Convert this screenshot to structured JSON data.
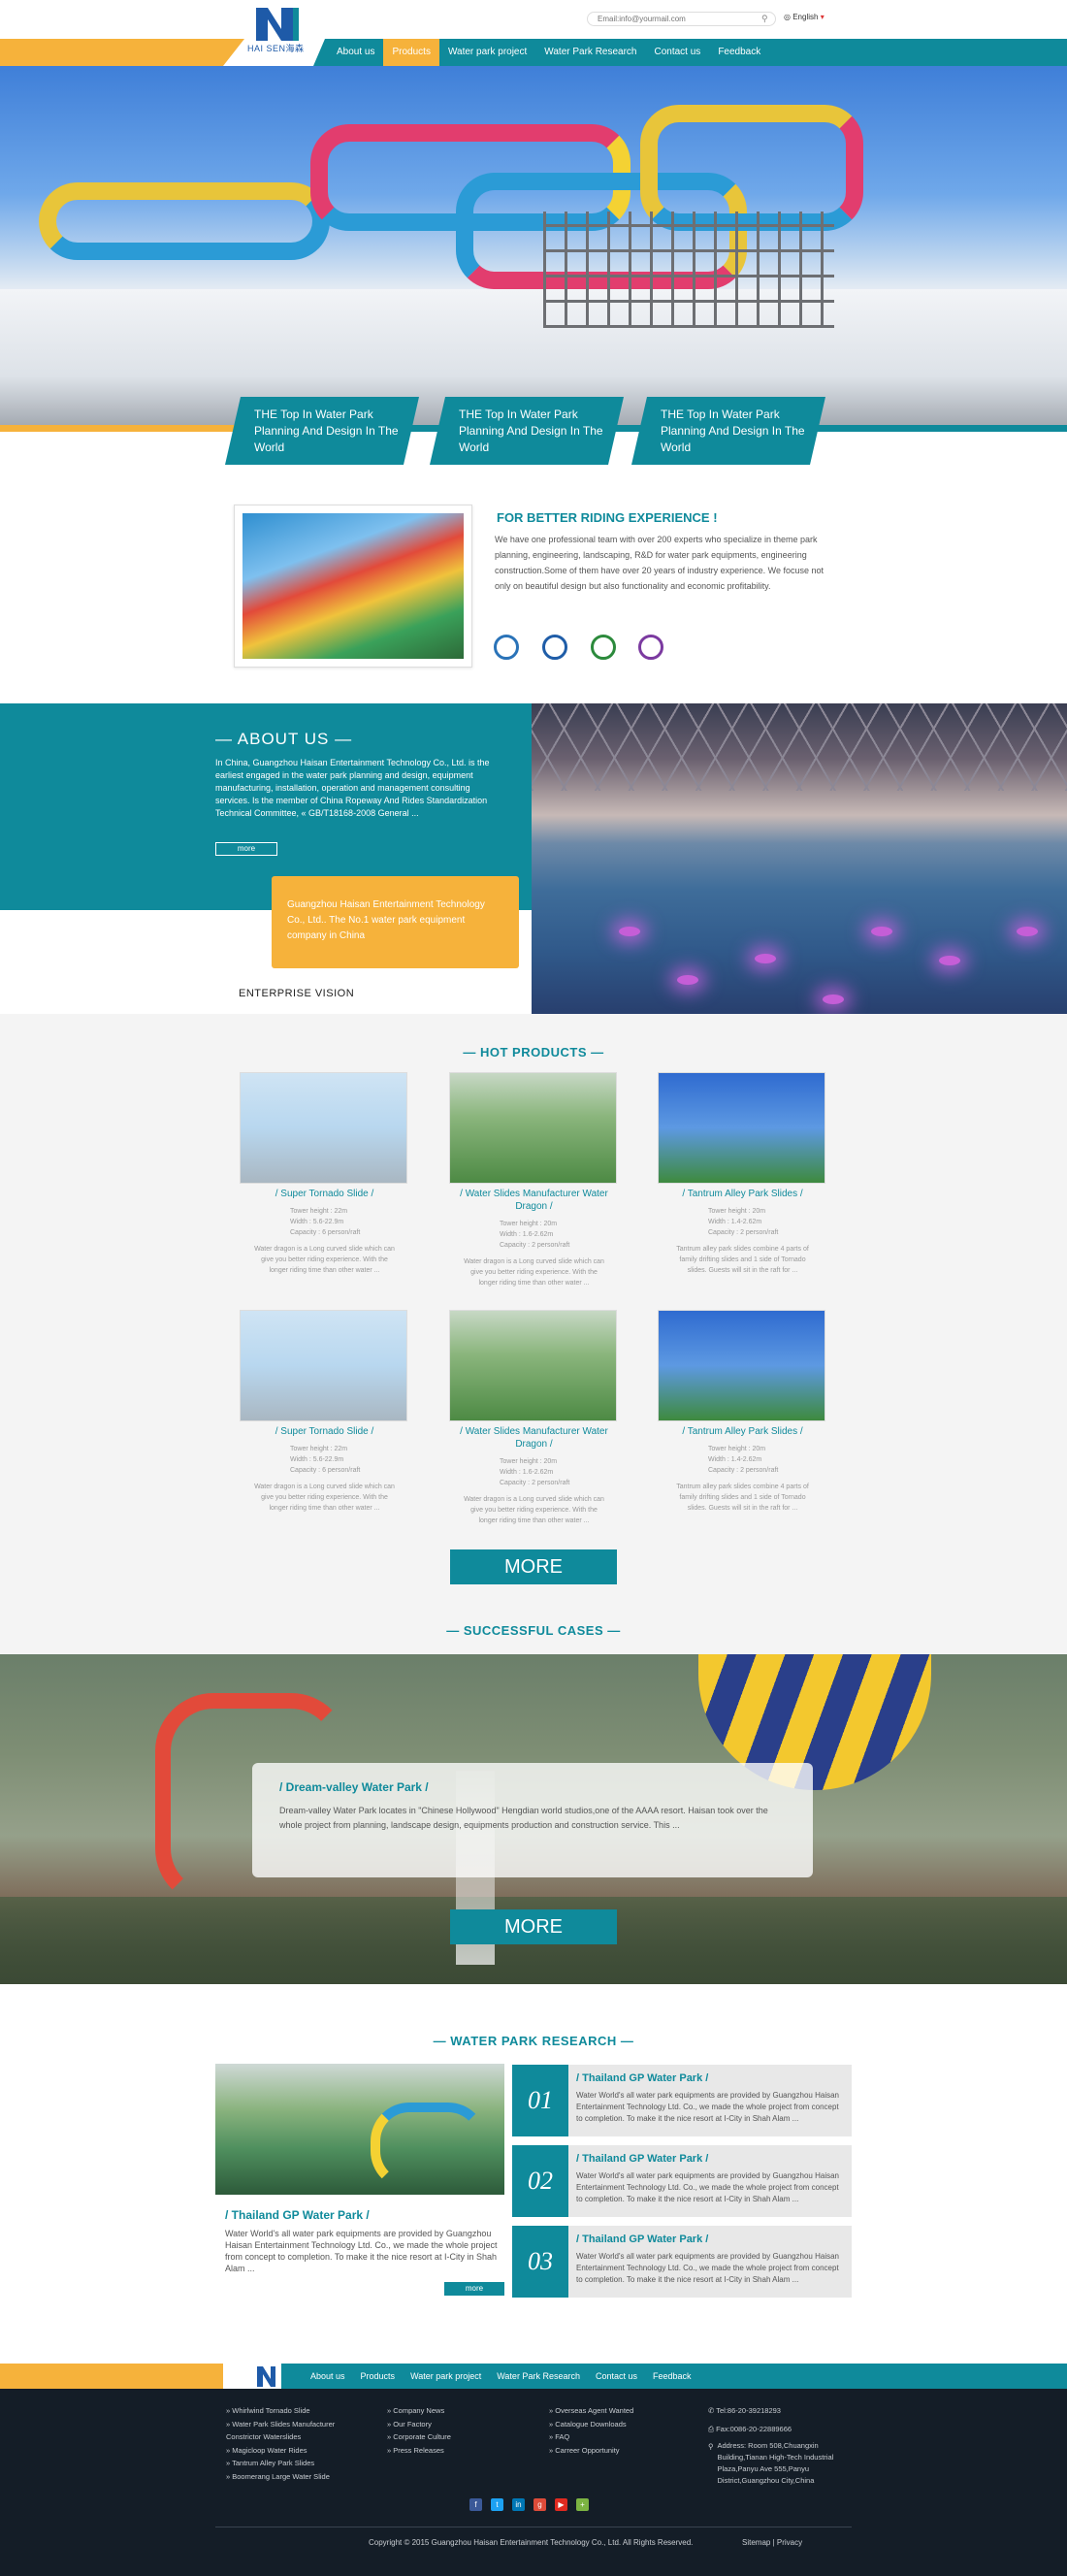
{
  "header": {
    "brand": "HAI SEN海森",
    "search_placeholder": "Email:info@yourmail.com",
    "language": "English",
    "nav": [
      "About us",
      "Products",
      "Water park project",
      "Water Park Research",
      "Contact us",
      "Feedback"
    ],
    "active_nav": "Products"
  },
  "hero": {
    "cards": [
      "THE Top In Water Park Planning And Design In The World",
      "THE Top In Water Park Planning And Design In The World",
      "THE Top In Water Park Planning And Design In The World"
    ]
  },
  "intro": {
    "title": "FOR BETTER RIDING EXPERIENCE !",
    "text": "We have one professional team with over 200 experts who specialize in theme park planning, engineering, landscaping, R&D for water park equipments, engineering construction.Some of them have over 20 years of industry experience. We focuse not only on beautiful design but also functionality and economic profitability."
  },
  "about": {
    "title": "— ABOUT US —",
    "text": "In China, Guangzhou Haisan Entertainment Technology Co., Ltd. is the earliest engaged in the water park planning and design, equipment manufacturing, installation, operation and management consulting services. Is the member of China Ropeway And Rides Standardization Technical Committee, « GB/T18168-2008 General ...",
    "more": "more",
    "highlight": "Guangzhou Haisan Entertainment Technology Co., Ltd.. The No.1 water park equipment company in China",
    "vision": "ENTERPRISE VISION"
  },
  "hot_products": {
    "title": "— HOT PRODUCTS —",
    "items": [
      {
        "name": "/ Super Tornado Slide /",
        "specs": [
          "Tower height : 22m",
          "Width : 5.6-22.9m",
          "Capacity : 6 person/raft"
        ],
        "desc": "Water dragon is a Long curved slide which can give you better riding experience. With the longer riding time than other water ..."
      },
      {
        "name": "/ Water Slides Manufacturer Water Dragon /",
        "specs": [
          "Tower height : 20m",
          "Width : 1.6-2.62m",
          "Capacity : 2 person/raft"
        ],
        "desc": "Water dragon is a Long curved slide which can give you better riding experience. With the longer riding time than other water ..."
      },
      {
        "name": "/ Tantrum Alley Park Slides /",
        "specs": [
          "Tower height : 20m",
          "Width : 1.4-2.62m",
          "Capacity : 2 person/raft"
        ],
        "desc": "Tantrum alley park slides combine 4 parts of family drifting slides and 1 side of Tornado slides. Guests will sit in the raft for ..."
      },
      {
        "name": "/ Super Tornado Slide /",
        "specs": [
          "Tower height : 22m",
          "Width : 5.6-22.9m",
          "Capacity : 6 person/raft"
        ],
        "desc": "Water dragon is a Long curved slide which can give you better riding experience. With the longer riding time than other water ..."
      },
      {
        "name": "/ Water Slides Manufacturer Water Dragon /",
        "specs": [
          "Tower height : 20m",
          "Width : 1.6-2.62m",
          "Capacity : 2 person/raft"
        ],
        "desc": "Water dragon is a Long curved slide which can give you better riding experience. With the longer riding time than other water ..."
      },
      {
        "name": "/ Tantrum Alley Park Slides /",
        "specs": [
          "Tower height : 20m",
          "Width : 1.4-2.62m",
          "Capacity : 2 person/raft"
        ],
        "desc": "Tantrum alley park slides combine 4 parts of family drifting slides and 1 side of Tornado slides. Guests will sit in the raft for ..."
      }
    ],
    "more": "MORE"
  },
  "cases": {
    "title": "— SUCCESSFUL CASES —",
    "card_title": "/ Dream-valley Water Park /",
    "card_text": "Dream-valley Water Park locates in \"Chinese Hollywood\" Hengdian world studios,one of the AAAA resort. Haisan took over the whole project from planning, landscape design, equipments production and construction service. This ...",
    "more": "MORE"
  },
  "research": {
    "title": "— WATER PARK RESEARCH —",
    "feature_title": "/ Thailand GP Water Park /",
    "feature_text": "Water World's all water park equipments are provided by Guangzhou Haisan Entertainment Technology Ltd. Co., we made the whole project from concept to completion. To make it the nice resort at I-City in Shah Alam ...",
    "more": "more",
    "items": [
      {
        "num": "01",
        "title": "/ Thailand GP Water Park /",
        "text": "Water World's all water park equipments are provided by Guangzhou Haisan Entertainment Technology Ltd. Co., we made the whole project from concept to completion. To make it the nice resort at I-City in Shah Alam ..."
      },
      {
        "num": "02",
        "title": "/ Thailand GP Water Park /",
        "text": "Water World's all water park equipments are provided by Guangzhou Haisan Entertainment Technology Ltd. Co., we made the whole project from concept to completion. To make it the nice resort at I-City in Shah Alam ..."
      },
      {
        "num": "03",
        "title": "/ Thailand GP Water Park /",
        "text": "Water World's all water park equipments are provided by Guangzhou Haisan Entertainment Technology Ltd. Co., we made the whole project from concept to completion. To make it the nice resort at I-City in Shah Alam ..."
      }
    ]
  },
  "footer": {
    "nav": [
      "About us",
      "Products",
      "Water park project",
      "Water Park Research",
      "Contact us",
      "Feedback"
    ],
    "col1": [
      "» Whirlwind Tornado Slide",
      "» Water Park Slides Manufacturer",
      "  Constrictor Waterslides",
      "» Magicloop Water Rides",
      "» Tantrum Alley Park Slides",
      "» Boomerang Large Water Slide"
    ],
    "col2": [
      "» Company News",
      "» Our Factory",
      "» Corporate Culture",
      "» Press Releases"
    ],
    "col3": [
      "» Overseas Agent Wanted",
      "» Catalogue Downloads",
      "» FAQ",
      "» Carreer Opportunity"
    ],
    "tel": "Tel:86-20-39218293",
    "fax": "Fax:0086-20-22889666",
    "address": "Address: Room 508,Chuangxin Building,Tianan High-Tech Industrial Plaza,Panyu Ave 555,Panyu District,Guangzhou City,China",
    "copyright": "Copyright © 2015 Guangzhou Haisan Entertainment Technology Co., Ltd. All Rights Reserved.",
    "sitemap": "Sitemap | Privacy"
  },
  "colors": {
    "teal": "#0f8a9b",
    "orange": "#f6b23b",
    "footer": "#141d27"
  }
}
